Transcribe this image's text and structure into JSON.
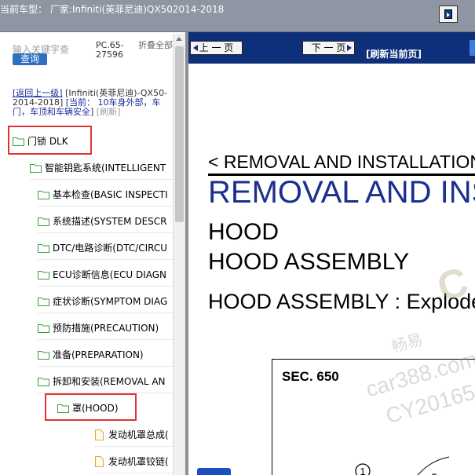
{
  "window": {
    "title": "当前车型：  厂家:Infiniti(英菲尼迪)QX502014-2018"
  },
  "left": {
    "search": {
      "placeholder": "输入关键字查",
      "button": "查询"
    },
    "pc_code": "PC.65-27596",
    "fold_all": "折叠全部",
    "breadcrumb": {
      "back": "[返回上一级]",
      "model": "[Infiniti(英菲尼迪)-QX50-2014-2018]",
      "current_label": "[当前：",
      "current_value": "10车身外部，车门，车顶和车辆安全]",
      "refresh": "[刷新]"
    },
    "tree": [
      {
        "label": "门锁 DLK",
        "type": "folder"
      },
      {
        "label": "智能钥匙系统(INTELLIGENT",
        "type": "folder"
      },
      {
        "label": "基本检查(BASIC INSPECTI",
        "type": "folder"
      },
      {
        "label": "系统描述(SYSTEM DESCR",
        "type": "folder"
      },
      {
        "label": "DTC/电路诊断(DTC/CIRCU",
        "type": "folder"
      },
      {
        "label": "ECU诊断信息(ECU DIAGN",
        "type": "folder"
      },
      {
        "label": "症状诊断(SYMPTOM DIAG",
        "type": "folder"
      },
      {
        "label": "预防措施(PRECAUTION)",
        "type": "folder"
      },
      {
        "label": "准备(PREPARATION)",
        "type": "folder"
      },
      {
        "label": "拆卸和安装(REMOVAL AN",
        "type": "folder"
      },
      {
        "label": "罩(HOOD)",
        "type": "folder"
      },
      {
        "label": "发动机罩总成(",
        "type": "doc"
      },
      {
        "label": "发动机罩铰链(",
        "type": "doc"
      }
    ]
  },
  "viewer": {
    "prev": "上 一 页",
    "next": "下 一 页",
    "refresh": "[刷新当前页]",
    "header": "< REMOVAL AND INSTALLATION >",
    "title": "REMOVAL AND INSTALLATION",
    "section1": "HOOD",
    "section2": "HOOD ASSEMBLY",
    "section3": "HOOD ASSEMBLY : Exploded View",
    "figure_caption": "SEC. 650",
    "figure_callout": "1",
    "watermark": {
      "line1": "畅易",
      "line2": "car388.com",
      "line3": "CY20165"
    }
  },
  "colors": {
    "nav_bg": "#0e2f7a",
    "title_blue": "#1b2f8f",
    "highlight_red": "#e03434",
    "titlebar": "#8f95a3"
  }
}
